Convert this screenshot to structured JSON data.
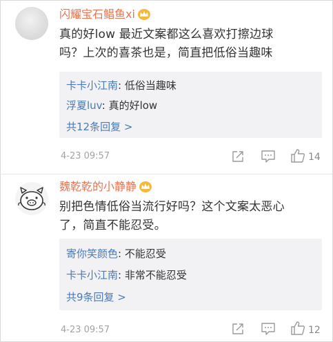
{
  "comments": [
    {
      "username": "闪耀宝石鲳鱼xi",
      "text_lines": [
        "真的好low 最近文案都这么喜欢打擦边球",
        "吗？上次的喜茶也是，简直把低俗当趣味"
      ],
      "replies": [
        {
          "user": "卡卡小江南",
          "sep": ": ",
          "text": "低俗当趣味"
        },
        {
          "user": "浮夏luv",
          "sep": ": ",
          "text": "真的好low"
        }
      ],
      "more_replies": "共12条回复 >",
      "time": "4-23 09:57",
      "likes": "14"
    },
    {
      "username": "魏乾乾的小静静",
      "text_lines": [
        "别把色情低俗当流行好吗？这个文案太恶心",
        "了，简直不能忍受。"
      ],
      "replies": [
        {
          "user": "寄你笑颜色",
          "sep": ": ",
          "text": "不能忍受"
        },
        {
          "user": "卡卡小江南",
          "sep": ": ",
          "text": "非常不能忍受"
        }
      ],
      "more_replies": "共9条回复 >",
      "time": "4-23 09:57",
      "likes": "12"
    }
  ],
  "icons": {
    "badge": "crown-badge-icon",
    "share": "share-icon",
    "comment": "comment-icon",
    "like": "thumbs-up-icon"
  },
  "colors": {
    "username": "#eb7350",
    "reply_user": "#4a79b8",
    "reply_bg": "#f2f2f5",
    "badge": "#f6b73c"
  }
}
